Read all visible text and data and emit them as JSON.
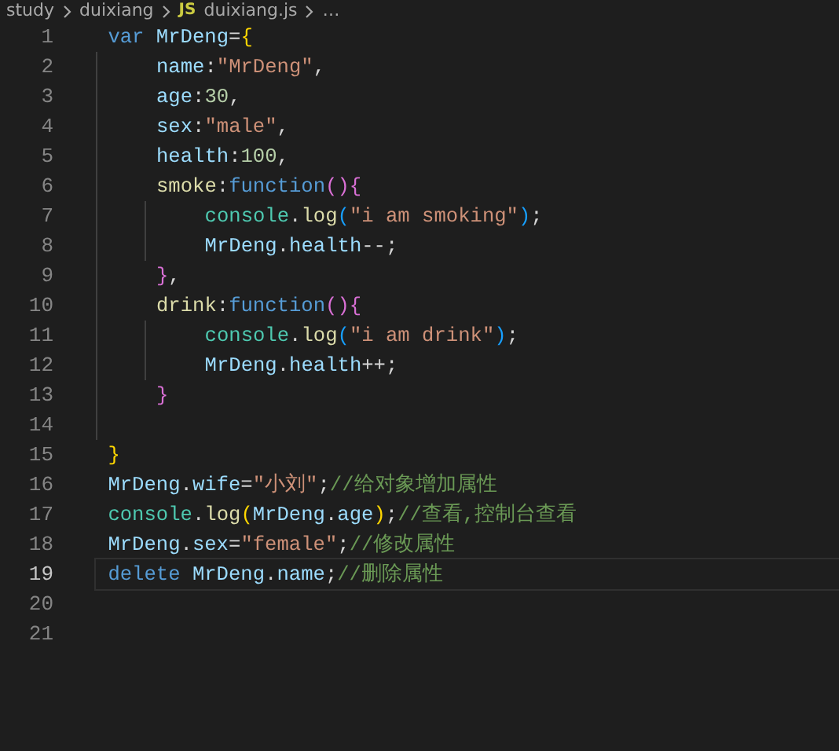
{
  "breadcrumb": {
    "items": [
      {
        "kind": "folder",
        "text": "study"
      },
      {
        "kind": "folder",
        "text": "duixiang"
      },
      {
        "kind": "file",
        "badge": "JS",
        "text": "duixiang.js"
      },
      {
        "kind": "more",
        "text": "…"
      }
    ]
  },
  "lines": [
    {
      "number": "1",
      "current": false,
      "tokens": [
        {
          "kind": "keyword",
          "text": "var"
        },
        {
          "kind": "variable",
          "gap": true,
          "text": "MrDeng"
        },
        {
          "kind": "punct",
          "text": "="
        },
        {
          "kind": "bracket1",
          "text": "{"
        }
      ],
      "children": [
        {
          "number": "2",
          "current": false,
          "tokens": [
            {
              "kind": "variable",
              "text": "name"
            },
            {
              "kind": "punct",
              "text": ":"
            },
            {
              "kind": "string",
              "text": "\"MrDeng\""
            },
            {
              "kind": "punct",
              "text": ","
            }
          ]
        },
        {
          "number": "3",
          "current": false,
          "tokens": [
            {
              "kind": "variable",
              "text": "age"
            },
            {
              "kind": "punct",
              "text": ":"
            },
            {
              "kind": "number",
              "text": "30"
            },
            {
              "kind": "punct",
              "text": ","
            }
          ]
        },
        {
          "number": "4",
          "current": false,
          "tokens": [
            {
              "kind": "variable",
              "text": "sex"
            },
            {
              "kind": "punct",
              "text": ":"
            },
            {
              "kind": "string",
              "text": "\"male\""
            },
            {
              "kind": "punct",
              "text": ","
            }
          ]
        },
        {
          "number": "5",
          "current": false,
          "tokens": [
            {
              "kind": "variable",
              "text": "health"
            },
            {
              "kind": "punct",
              "text": ":"
            },
            {
              "kind": "number",
              "text": "100"
            },
            {
              "kind": "punct",
              "text": ","
            }
          ]
        },
        {
          "number": "6",
          "current": false,
          "tokens": [
            {
              "kind": "method",
              "text": "smoke"
            },
            {
              "kind": "punct",
              "text": ":"
            },
            {
              "kind": "keyword",
              "text": "function"
            },
            {
              "kind": "bracket2",
              "text": "(){"
            }
          ],
          "children": [
            {
              "number": "7",
              "current": false,
              "tokens": [
                {
                  "kind": "class",
                  "text": "console"
                },
                {
                  "kind": "punct",
                  "text": "."
                },
                {
                  "kind": "method",
                  "text": "log"
                },
                {
                  "kind": "bracket3",
                  "text": "("
                },
                {
                  "kind": "string",
                  "text": "\"i am smoking\""
                },
                {
                  "kind": "bracket3",
                  "text": ")"
                },
                {
                  "kind": "punct",
                  "text": ";"
                }
              ]
            },
            {
              "number": "8",
              "current": false,
              "tokens": [
                {
                  "kind": "variable",
                  "text": "MrDeng"
                },
                {
                  "kind": "punct",
                  "text": "."
                },
                {
                  "kind": "variable",
                  "text": "health"
                },
                {
                  "kind": "punct",
                  "text": "--;"
                }
              ]
            }
          ]
        },
        {
          "number": "9",
          "current": false,
          "tokens": [
            {
              "kind": "bracket2",
              "text": "}"
            },
            {
              "kind": "punct",
              "text": ","
            }
          ]
        },
        {
          "number": "10",
          "current": false,
          "tokens": [
            {
              "kind": "method",
              "text": "drink"
            },
            {
              "kind": "punct",
              "text": ":"
            },
            {
              "kind": "keyword",
              "text": "function"
            },
            {
              "kind": "bracket2",
              "text": "(){"
            }
          ],
          "children": [
            {
              "number": "11",
              "current": false,
              "tokens": [
                {
                  "kind": "class",
                  "text": "console"
                },
                {
                  "kind": "punct",
                  "text": "."
                },
                {
                  "kind": "method",
                  "text": "log"
                },
                {
                  "kind": "bracket3",
                  "text": "("
                },
                {
                  "kind": "string",
                  "text": "\"i am drink\""
                },
                {
                  "kind": "bracket3",
                  "text": ")"
                },
                {
                  "kind": "punct",
                  "text": ";"
                }
              ]
            },
            {
              "number": "12",
              "current": false,
              "tokens": [
                {
                  "kind": "variable",
                  "text": "MrDeng"
                },
                {
                  "kind": "punct",
                  "text": "."
                },
                {
                  "kind": "variable",
                  "text": "health"
                },
                {
                  "kind": "punct",
                  "text": "++;"
                }
              ]
            }
          ]
        },
        {
          "number": "13",
          "current": false,
          "tokens": [
            {
              "kind": "bracket2",
              "text": "}"
            }
          ]
        },
        {
          "number": "14",
          "current": false
        }
      ]
    },
    {
      "number": "15",
      "current": false,
      "tokens": [
        {
          "kind": "bracket1",
          "text": "}"
        }
      ]
    },
    {
      "number": "16",
      "current": false,
      "tokens": [
        {
          "kind": "variable",
          "text": "MrDeng"
        },
        {
          "kind": "punct",
          "text": "."
        },
        {
          "kind": "variable",
          "text": "wife"
        },
        {
          "kind": "punct",
          "text": "="
        },
        {
          "kind": "string",
          "text": "\"小刘\""
        },
        {
          "kind": "punct",
          "text": ";"
        },
        {
          "kind": "comment",
          "text": "//给对象增加属性"
        }
      ]
    },
    {
      "number": "17",
      "current": false,
      "tokens": [
        {
          "kind": "class",
          "text": "console"
        },
        {
          "kind": "punct",
          "text": "."
        },
        {
          "kind": "method",
          "text": "log"
        },
        {
          "kind": "bracket1",
          "text": "("
        },
        {
          "kind": "variable",
          "text": "MrDeng"
        },
        {
          "kind": "punct",
          "text": "."
        },
        {
          "kind": "variable",
          "text": "age"
        },
        {
          "kind": "bracket1",
          "text": ")"
        },
        {
          "kind": "punct",
          "text": ";"
        },
        {
          "kind": "comment",
          "text": "//查看,控制台查看"
        }
      ]
    },
    {
      "number": "18",
      "current": false,
      "tokens": [
        {
          "kind": "variable",
          "text": "MrDeng"
        },
        {
          "kind": "punct",
          "text": "."
        },
        {
          "kind": "variable",
          "text": "sex"
        },
        {
          "kind": "punct",
          "text": "="
        },
        {
          "kind": "string",
          "text": "\"female\""
        },
        {
          "kind": "punct",
          "text": ";"
        },
        {
          "kind": "comment",
          "text": "//修改属性"
        }
      ]
    },
    {
      "number": "19",
      "current": true,
      "tokens": [
        {
          "kind": "keyword",
          "text": "delete"
        },
        {
          "kind": "variable",
          "gap": true,
          "text": "MrDeng"
        },
        {
          "kind": "punct",
          "text": "."
        },
        {
          "kind": "variable",
          "text": "name"
        },
        {
          "kind": "punct",
          "text": ";"
        },
        {
          "kind": "comment",
          "text": "//删除属性"
        }
      ]
    },
    {
      "number": "20",
      "current": false
    },
    {
      "number": "21",
      "current": false
    }
  ]
}
